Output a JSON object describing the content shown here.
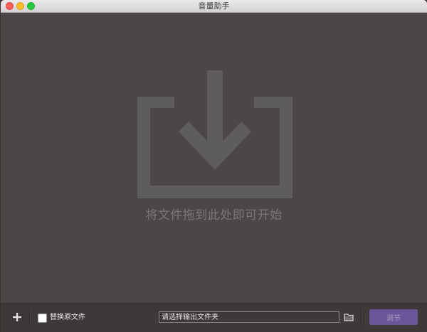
{
  "window": {
    "title": "音量助手"
  },
  "drop_zone": {
    "icon": "download-tray-icon",
    "message": "将文件拖到此处即可开始"
  },
  "toolbar": {
    "add_icon": "plus-icon",
    "replace_original_label": "替换原文件",
    "replace_original_checked": false,
    "output_folder_placeholder": "请选择输出文件夹",
    "output_folder_value": "",
    "folder_icon": "folder-icon",
    "adjust_button_label": "调节"
  },
  "colors": {
    "background": "#4b4747",
    "drop_icon": "#5f5c5c",
    "drop_text": "#7a7777",
    "bottom_bar": "#3d3939",
    "accent_button": "#6b559a"
  }
}
